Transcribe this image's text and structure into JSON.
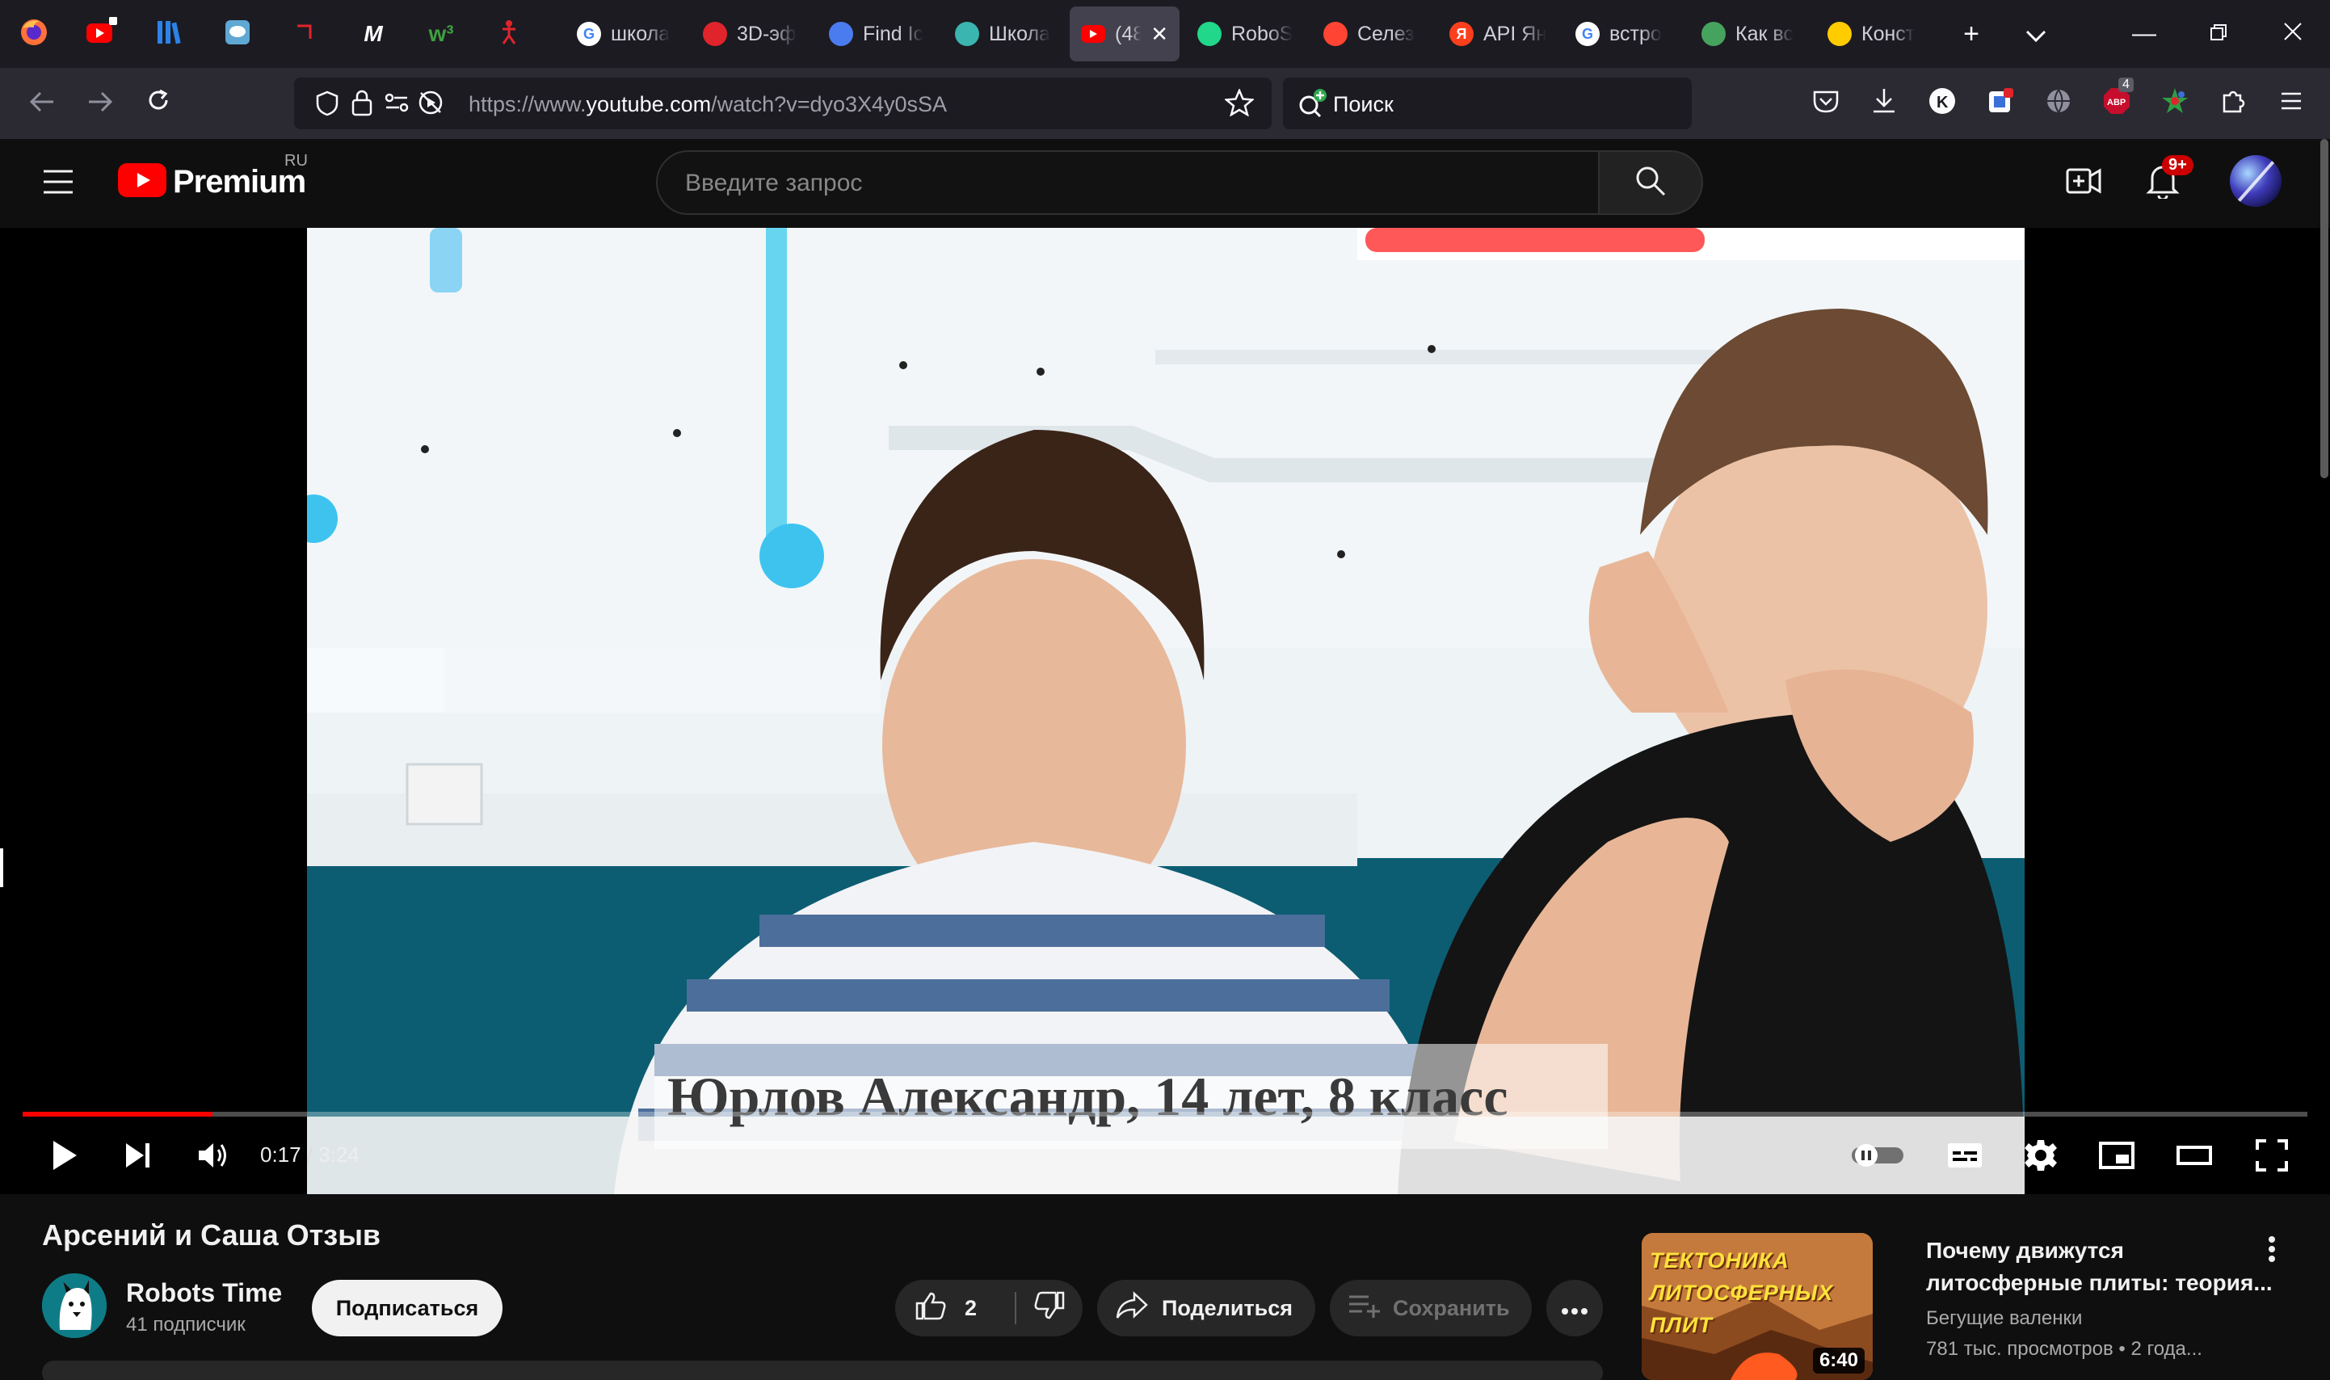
{
  "tabstrip": {
    "pinned": [
      {
        "icon": "firefox-icon",
        "color": "#ff7139"
      },
      {
        "icon": "youtube-sound-icon",
        "color": "#ff0000"
      },
      {
        "icon": "library-icon",
        "color": "#2b83e9"
      },
      {
        "icon": "chat-icon",
        "color": "#5fa8d3"
      },
      {
        "icon": "red-bracket-icon",
        "color": "#e0242c"
      },
      {
        "icon": "m-icon",
        "glyph": "M",
        "color": "#ffffff"
      },
      {
        "icon": "w3-icon",
        "glyph": "w³",
        "color": "#3fa03f"
      },
      {
        "icon": "red-figure-icon",
        "color": "#e0242c"
      }
    ],
    "tabs": [
      {
        "label": "школа",
        "icon": "google-icon",
        "color": "#ffffff"
      },
      {
        "label": "3D-эф",
        "icon": "red-diamond-icon",
        "color": "#e0242c"
      },
      {
        "label": "Find Ic",
        "icon": "flag-icon",
        "color": "#4a7cf0"
      },
      {
        "label": "Школа",
        "icon": "school-icon",
        "color": "#3ab5b0"
      },
      {
        "label": "(48",
        "icon": "youtube-icon",
        "color": "#ff0000",
        "active": true
      },
      {
        "label": "RoboS",
        "icon": "pycharm-icon",
        "color": "#21d789"
      },
      {
        "label": "Селез",
        "icon": "map-pin-icon",
        "color": "#ff4433"
      },
      {
        "label": "API Ян",
        "icon": "yandex-icon",
        "color": "#fc3f1d"
      },
      {
        "label": "встро",
        "icon": "google-icon",
        "color": "#ffffff"
      },
      {
        "label": "Как вс",
        "icon": "green-arrow-icon",
        "color": "#46a35e"
      },
      {
        "label": "Конст",
        "icon": "yandex-maps-icon",
        "color": "#ffcc00"
      }
    ],
    "new_tab": "+",
    "list_all": "⌄"
  },
  "navbar": {
    "url_prefix": "https://www.",
    "url_domain": "youtube.com",
    "url_path": "/watch?v=dyo3X4y0sSA",
    "search_label": "Поиск",
    "extension_badge": "4"
  },
  "youtube": {
    "logo_text": "Premium",
    "region": "RU",
    "search_placeholder": "Введите запрос",
    "notifications_badge": "9+"
  },
  "player": {
    "caption": "Юрлов Александр, 14 лет, 8 класс",
    "current_time": "0:17",
    "duration": "3:24",
    "progress_fraction": 0.083
  },
  "video_info": {
    "title": "Арсений и Саша Отзыв",
    "channel": "Robots Time",
    "subscribers": "41 подписчик",
    "subscribe_label": "Подписаться",
    "likes": "2",
    "share_label": "Поделиться",
    "save_label": "Сохранить"
  },
  "recommendation": {
    "thumb_line1": "ТЕКТОНИКА",
    "thumb_line2": "ЛИТОСФЕРНЫХ ПЛИТ",
    "duration": "6:40",
    "title_line1": "Почему движутся",
    "title_line2": "литосферные плиты: теория...",
    "channel": "Бегущие валенки",
    "views": "781 тыс. просмотров",
    "age": "• 2 года..."
  }
}
